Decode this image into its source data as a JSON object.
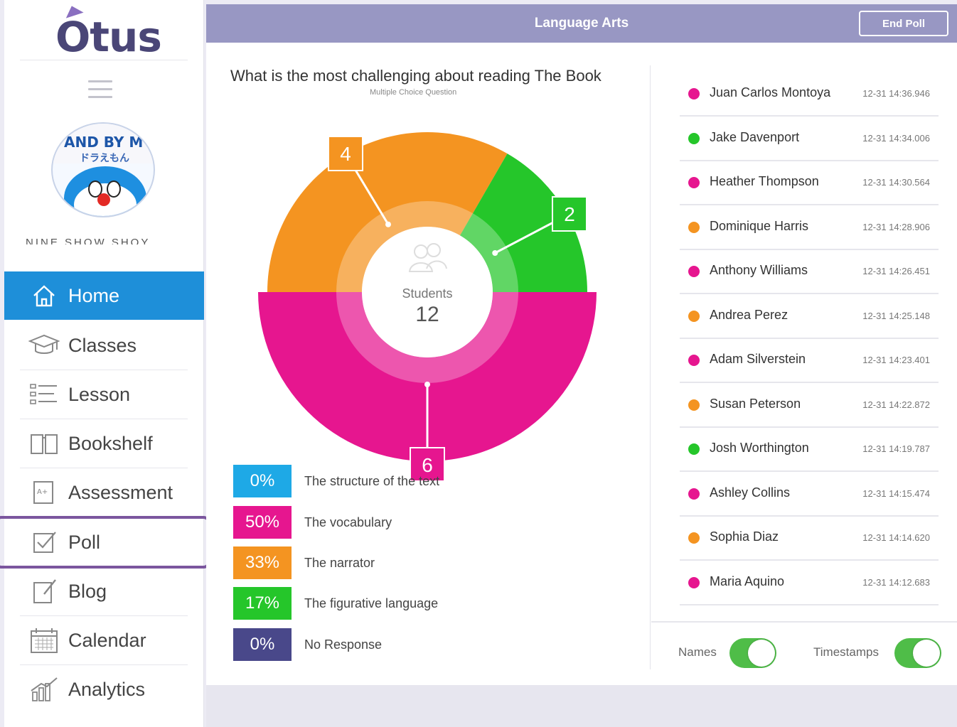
{
  "sidebar": {
    "logo_text": "Otus",
    "avatar": {
      "text_line1": "AND BY M",
      "text_line2": "ドラえもん"
    },
    "username": "NINE SHOW SHOY",
    "items": [
      {
        "label": "Home",
        "icon": "home-icon",
        "active": true
      },
      {
        "label": "Classes",
        "icon": "graduation-cap-icon"
      },
      {
        "label": "Lesson",
        "icon": "list-icon"
      },
      {
        "label": "Bookshelf",
        "icon": "book-icon"
      },
      {
        "label": "Assessment",
        "icon": "assessment-icon"
      },
      {
        "label": "Poll",
        "icon": "poll-icon",
        "highlighted": true
      },
      {
        "label": "Blog",
        "icon": "edit-icon"
      },
      {
        "label": "Calendar",
        "icon": "calendar-icon"
      },
      {
        "label": "Analytics",
        "icon": "analytics-icon"
      }
    ]
  },
  "header": {
    "title": "Language Arts",
    "end_poll_label": "End Poll"
  },
  "poll": {
    "question": "What is the most challenging about reading The Book",
    "question_type": "Multiple Choice Question",
    "center_label": "Students",
    "center_count": "12"
  },
  "chart_data": {
    "type": "pie",
    "categories": [
      "The structure of the text",
      "The vocabulary",
      "The narrator",
      "The figurative language",
      "No Response"
    ],
    "counts": [
      0,
      6,
      4,
      2,
      0
    ],
    "percents": [
      0,
      50,
      33,
      17,
      0
    ],
    "colors": [
      "#1ea9e6",
      "#e6168f",
      "#f49421",
      "#25c62a",
      "#49488a"
    ]
  },
  "legend": [
    {
      "percent": "0%",
      "label": "The structure of the text",
      "color": "#1ea9e6"
    },
    {
      "percent": "50%",
      "label": "The vocabulary",
      "color": "#e6168f"
    },
    {
      "percent": "33%",
      "label": "The narrator",
      "color": "#f49421"
    },
    {
      "percent": "17%",
      "label": "The figurative language",
      "color": "#25c62a"
    },
    {
      "percent": "0%",
      "label": "No Response",
      "color": "#49488a"
    }
  ],
  "callouts": {
    "orange": "4",
    "green": "2",
    "pink": "6"
  },
  "responses": [
    {
      "name": "Juan Carlos Montoya",
      "time": "12-31 14:36.946",
      "color": "#e6168f"
    },
    {
      "name": "Jake Davenport",
      "time": "12-31 14:34.006",
      "color": "#25c62a"
    },
    {
      "name": "Heather Thompson",
      "time": "12-31 14:30.564",
      "color": "#e6168f"
    },
    {
      "name": "Dominique Harris",
      "time": "12-31 14:28.906",
      "color": "#f49421"
    },
    {
      "name": "Anthony Williams",
      "time": "12-31 14:26.451",
      "color": "#e6168f"
    },
    {
      "name": "Andrea Perez",
      "time": "12-31 14:25.148",
      "color": "#f49421"
    },
    {
      "name": "Adam Silverstein",
      "time": "12-31 14:23.401",
      "color": "#e6168f"
    },
    {
      "name": "Susan Peterson",
      "time": "12-31 14:22.872",
      "color": "#f49421"
    },
    {
      "name": "Josh Worthington",
      "time": "12-31 14:19.787",
      "color": "#25c62a"
    },
    {
      "name": "Ashley Collins",
      "time": "12-31 14:15.474",
      "color": "#e6168f"
    },
    {
      "name": "Sophia Diaz",
      "time": "12-31 14:14.620",
      "color": "#f49421"
    },
    {
      "name": "Maria Aquino",
      "time": "12-31 14:12.683",
      "color": "#e6168f"
    }
  ],
  "footer": {
    "names_label": "Names",
    "timestamps_label": "Timestamps",
    "names_on": true,
    "timestamps_on": true
  }
}
